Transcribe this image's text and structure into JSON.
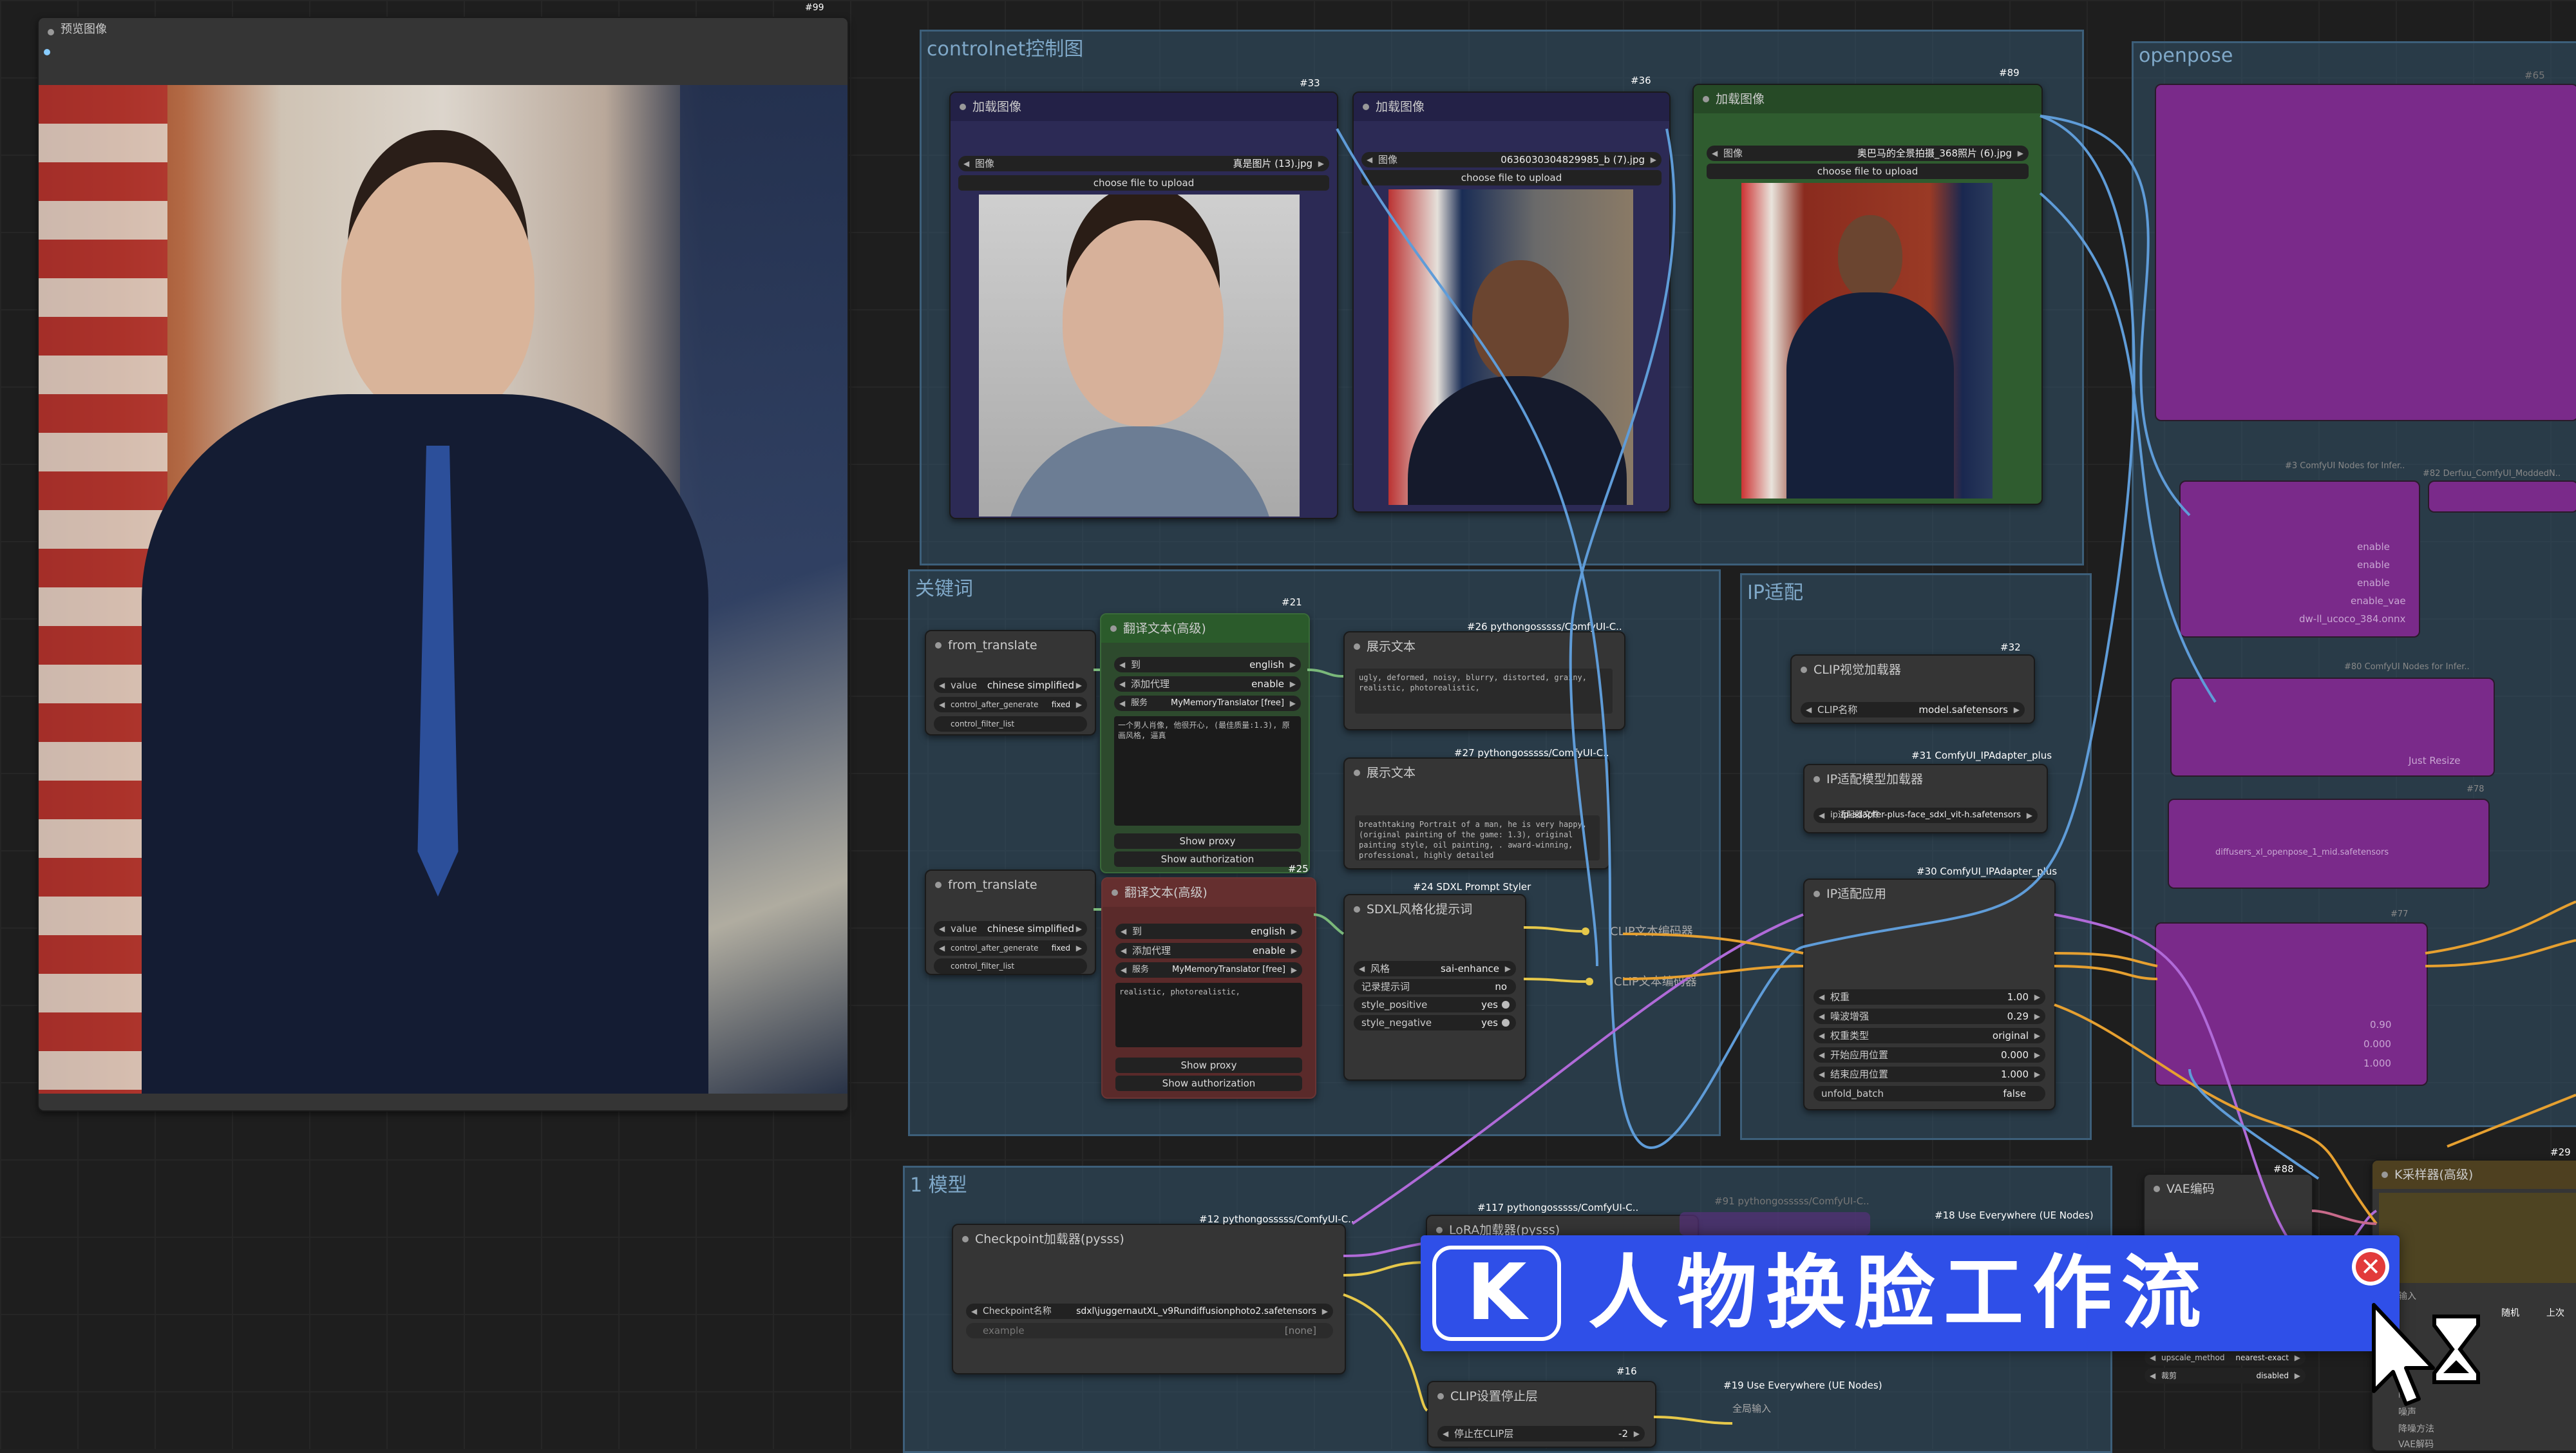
{
  "preview": {
    "title": "预览图像",
    "id": "#99"
  },
  "groups": {
    "controlnet": "controlnet控制图",
    "keywords": "关键词",
    "ip_adapt": "IP适配",
    "model": "1 模型",
    "openpose": "openpose"
  },
  "load_nodes": [
    {
      "id": "#33",
      "title": "加载图像",
      "label": "图像",
      "value": "真是图片 (13).jpg",
      "button": "choose file to upload"
    },
    {
      "id": "#36",
      "title": "加载图像",
      "label": "图像",
      "value": "0636030304829985_b (7).jpg",
      "button": "choose file to upload"
    },
    {
      "id": "#89",
      "title": "加载图像",
      "label": "图像",
      "value": "奥巴马的全景拍摄_368照片 (6).jpg",
      "button": "choose file to upload"
    }
  ],
  "from_translate_1": {
    "title": "from_translate",
    "w1l": "value",
    "w1v": "chinese simplified",
    "w2l": "control_after_generate",
    "w2v": "fixed",
    "w3": "control_filter_list"
  },
  "from_translate_2": {
    "title": "from_translate",
    "w1l": "value",
    "w1v": "chinese simplified",
    "w2l": "control_after_generate",
    "w2v": "fixed",
    "w3": "control_filter_list"
  },
  "translate_pos": {
    "id": "#21",
    "title": "翻译文本(高级)",
    "w1l": "到",
    "w1v": "english",
    "w2l": "添加代理",
    "w2v": "enable",
    "w3l": "服务",
    "w3v": "MyMemoryTranslator [free]",
    "text": "一个男人肖像, 他很开心, (最佳质量:1.3), 原画风格, 逼真",
    "btn1": "Show proxy",
    "btn2": "Show authorization"
  },
  "translate_neg": {
    "id": "#25",
    "title": "翻译文本(高级)",
    "w1l": "到",
    "w1v": "english",
    "w2l": "添加代理",
    "w2v": "enable",
    "w3l": "服务",
    "w3v": "MyMemoryTranslator [free]",
    "text": "realistic, photorealistic,",
    "btn1": "Show proxy",
    "btn2": "Show authorization"
  },
  "show_text_1": {
    "id": "#26 pythongosssss/ComfyUI-C..",
    "title": "展示文本",
    "text": "ugly, deformed, noisy, blurry, distorted, grainy, realistic, photorealistic,"
  },
  "show_text_2": {
    "id": "#27 pythongosssss/ComfyUI-C..",
    "title": "展示文本",
    "text": "breathtaking Portrait of a man, he is very happy, (original painting of the game: 1.3), original painting style, oil painting, . award-winning, professional, highly detailed"
  },
  "sdxl_styler": {
    "id": "#24 SDXL Prompt Styler",
    "title": "SDXL风格化提示词",
    "w1l": "风格",
    "w1v": "sai-enhance",
    "w2l": "记录提示词",
    "w2v": "no",
    "w3l": "style_positive",
    "w3v": "yes",
    "w4l": "style_negative",
    "w4v": "yes"
  },
  "clip_encode": [
    "CLIP文本编码器",
    "CLIP文本编码器"
  ],
  "clip_loader": {
    "id": "#32",
    "title": "CLIP视觉加载器",
    "label": "CLIP名称",
    "value": "model.safetensors"
  },
  "ip_model_loader": {
    "id": "#31 ComfyUI_IPAdapter_plus",
    "title": "IP适配模型加载器",
    "label": "ip适配器文件",
    "value": "ip-adapter-plus-face_sdxl_vit-h.safetensors"
  },
  "ip_apply": {
    "id": "#30 ComfyUI_IPAdapter_plus",
    "title": "IP适配应用",
    "widgets": [
      {
        "l": "权重",
        "v": "1.00"
      },
      {
        "l": "噪波增强",
        "v": "0.29"
      },
      {
        "l": "权重类型",
        "v": "original"
      },
      {
        "l": "开始应用位置",
        "v": "0.000"
      },
      {
        "l": "结束应用位置",
        "v": "1.000"
      },
      {
        "l": "unfold_batch",
        "v": "false"
      }
    ]
  },
  "checkpoint": {
    "id": "#12 pythongosssss/ComfyUI-C..",
    "title": "Checkpoint加载器(pysss)",
    "label": "Checkpoint名称",
    "value": "sdxl\\juggernautXL_v9Rundiffusionphoto2.safetensors",
    "example_l": "example",
    "example_v": "[none]"
  },
  "lora": {
    "id": "#117 pythongosssss/ComfyUI-C..",
    "title": "LoRA加载器(pysss)"
  },
  "lora_ghost": "#91 pythongosssss/ComfyUI-C..",
  "use_everywhere_18": "#18 Use Everywhere (UE Nodes)",
  "use_everywhere_19": "#19 Use Everywhere (UE Nodes)",
  "clip_stop": {
    "id": "#16",
    "title": "CLIP设置停止层",
    "label": "停止在CLIP层",
    "value": "-2"
  },
  "global_input": "全局输入",
  "vae": {
    "id": "#88",
    "title": "VAE编码"
  },
  "ksampler": {
    "id": "#29",
    "title": "K采样器(高级)"
  },
  "upscale": {
    "l": "upscale_method",
    "v": "nearest-exact",
    "l2": "裁剪",
    "v2": "disabled"
  },
  "openpose_nodes": {
    "n1": "#65",
    "n2": "#3 ComfyUI Nodes for Infer..",
    "n3": "#82 Derfuu_ComfyUI_ModdedN..",
    "n4": "#80 ComfyUI Nodes for Infer..",
    "n5": "#78",
    "n6": "#77",
    "w1": "enable",
    "w2": "enable",
    "w3": "enable",
    "w4": "enable_vae",
    "w5": "dw-ll_ucoco_384.onnx",
    "w6": "Just Resize",
    "w7": "diffusers_xl_openpose_1_mid.safetensors",
    "v1": "0.90",
    "v2": "0.000",
    "v3": "1.000"
  },
  "ks_right": {
    "a": "随机",
    "b": "上次"
  },
  "ks_labels": [
    "输入",
    "降噪",
    "噪声",
    "降噪方法",
    "VAE解码"
  ],
  "banner": {
    "text": "人物换脸工作流",
    "logo": "K"
  }
}
